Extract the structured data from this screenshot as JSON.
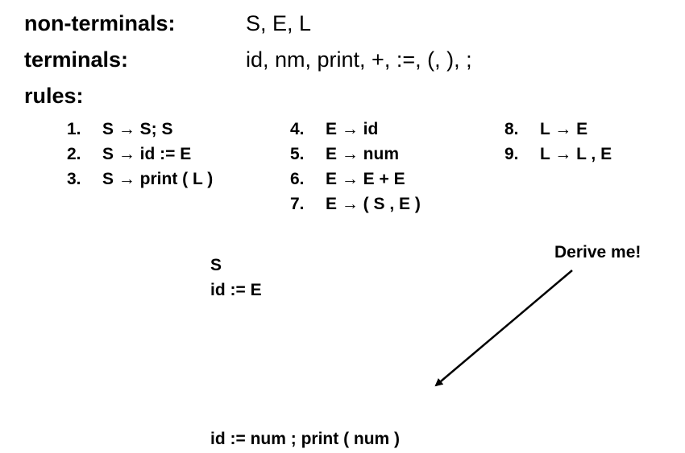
{
  "header": {
    "nonterminals_label": "non-terminals:",
    "nonterminals_value": "S, E, L",
    "terminals_label": "terminals:",
    "terminals_value": "id, nm, print, +, :=, (, ), ;",
    "rules_label": "rules:"
  },
  "rules": [
    {
      "num": "1.",
      "text": "S → S; S"
    },
    {
      "num": "2.",
      "text": "S → id := E"
    },
    {
      "num": "3.",
      "text": "S → print ( L )"
    },
    {
      "num": "4.",
      "text": "E → id"
    },
    {
      "num": "5.",
      "text": "E → num"
    },
    {
      "num": "6.",
      "text": "E → E + E"
    },
    {
      "num": "7.",
      "text": "E → ( S , E )"
    },
    {
      "num": "8.",
      "text": "L → E"
    },
    {
      "num": "9.",
      "text": "L → L , E"
    }
  ],
  "derivation": {
    "steps": [
      "S",
      "id := E"
    ],
    "target": "id := num ; print ( num )"
  },
  "callout": {
    "label": "Derive me!",
    "arrow_color": "#000000"
  }
}
